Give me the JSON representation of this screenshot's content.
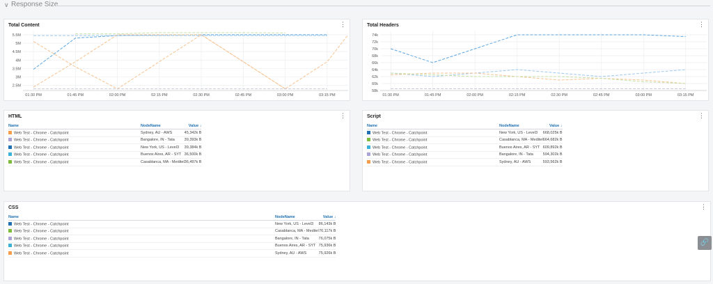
{
  "section": {
    "title": "Response Size",
    "chevron_icon": "chevron-down-icon"
  },
  "panels": {
    "total_content": {
      "title": "Total Content",
      "menu_icon": "more-vert-icon",
      "chart_data": {
        "type": "line",
        "title": "Total Content",
        "ylabel_unit": "M",
        "y_ticks": [
          "5.5M",
          "5M",
          "4.5M",
          "4M",
          "3.5M",
          "3M",
          "2.5M"
        ],
        "x_ticks": [
          "01:30 PM",
          "01:45 PM",
          "02:00 PM",
          "02:15 PM",
          "02:30 PM",
          "02:45 PM",
          "03:00 PM",
          "03:15 PM"
        ],
        "ylim": [
          2.2,
          5.7
        ],
        "grid": true,
        "series": [
          {
            "color": "#5aa5e0",
            "x": [
              "01:30 PM",
              "01:45 PM",
              "02:00 PM",
              "02:15 PM",
              "02:30 PM",
              "02:45 PM",
              "03:00 PM",
              "03:15 PM"
            ],
            "values": [
              3.45,
              5.3,
              5.45,
              5.48,
              5.5,
              5.5,
              5.5,
              5.5
            ]
          },
          {
            "color": "#f5c391",
            "x": [
              "01:30 PM",
              "01:45 PM",
              "02:00 PM",
              "02:15 PM",
              "02:30 PM",
              "02:45 PM",
              "03:00 PM",
              "03:15 PM",
              "03:30 PM"
            ],
            "values": [
              5.1,
              3.6,
              2.3,
              3.9,
              5.5,
              3.9,
              2.3,
              3.9,
              5.5
            ]
          },
          {
            "color": "#f5c391",
            "x": [
              "01:30 PM",
              "01:45 PM",
              "02:00 PM",
              "02:15 PM",
              "02:30 PM",
              "02:45 PM",
              "03:00 PM"
            ],
            "values": [
              2.4,
              3.9,
              5.5,
              5.5,
              5.5,
              3.9,
              2.3
            ]
          },
          {
            "color": "#c8e0a8",
            "x": [
              "01:45 PM",
              "02:00 PM",
              "02:15 PM",
              "02:30 PM",
              "02:45 PM",
              "03:00 PM"
            ],
            "values": [
              5.55,
              5.55,
              5.62,
              5.62,
              5.62,
              5.6
            ]
          },
          {
            "color": "#9ec9ee",
            "x": [
              "01:30 PM",
              "01:45 PM",
              "02:00 PM",
              "02:15 PM",
              "02:30 PM",
              "02:45 PM",
              "03:00 PM",
              "03:15 PM"
            ],
            "values": [
              5.45,
              5.45,
              5.45,
              5.45,
              5.45,
              5.45,
              5.45,
              5.45
            ]
          },
          {
            "color": "#c9c9d6",
            "x": [
              "01:30 PM",
              "01:45 PM",
              "02:00 PM",
              "02:15 PM",
              "02:30 PM",
              "02:45 PM",
              "03:00 PM",
              "03:15 PM"
            ],
            "values": [
              2.3,
              2.3,
              2.3,
              2.3,
              2.3,
              2.3,
              2.3,
              2.3
            ]
          }
        ]
      }
    },
    "total_headers": {
      "title": "Total Headers",
      "menu_icon": "more-vert-icon",
      "chart_data": {
        "type": "line",
        "title": "Total Headers",
        "y_ticks": [
          "74k",
          "72k",
          "70k",
          "68k",
          "66k",
          "64k",
          "62k",
          "60k",
          "58k"
        ],
        "x_ticks": [
          "01:30 PM",
          "01:45 PM",
          "02:00 PM",
          "02:15 PM",
          "02:30 PM",
          "02:45 PM",
          "03:00 PM",
          "03:15 PM"
        ],
        "ylim": [
          58,
          75
        ],
        "grid": true,
        "series": [
          {
            "color": "#5aa5e0",
            "x": [
              "01:30 PM",
              "01:45 PM",
              "02:00 PM",
              "02:15 PM",
              "02:30 PM",
              "02:45 PM",
              "03:00 PM",
              "03:15 PM"
            ],
            "values": [
              70,
              66,
              70,
              74,
              74,
              74,
              74,
              73.5
            ]
          },
          {
            "color": "#9ec9ee",
            "x": [
              "01:30 PM",
              "01:45 PM",
              "02:00 PM",
              "02:15 PM",
              "02:30 PM",
              "02:45 PM",
              "03:00 PM",
              "03:15 PM"
            ],
            "values": [
              63,
              62,
              63,
              64,
              63,
              62,
              63,
              64
            ]
          },
          {
            "color": "#f5c391",
            "x": [
              "01:30 PM",
              "01:45 PM",
              "02:00 PM",
              "02:15 PM",
              "02:30 PM",
              "02:45 PM",
              "03:00 PM",
              "03:15 PM"
            ],
            "values": [
              62.5,
              63,
              63,
              62,
              61,
              61.5,
              61,
              60
            ]
          },
          {
            "color": "#c8e0a8",
            "x": [
              "01:30 PM",
              "01:45 PM",
              "02:00 PM",
              "02:15 PM",
              "02:30 PM",
              "02:45 PM",
              "03:00 PM",
              "03:15 PM"
            ],
            "values": [
              63,
              62.5,
              62,
              62,
              62,
              61.5,
              60.5,
              60
            ]
          },
          {
            "color": "#c9c9d6",
            "x": [
              "01:30 PM",
              "01:45 PM",
              "02:00 PM",
              "02:15 PM",
              "02:30 PM",
              "02:45 PM",
              "03:00 PM",
              "03:15 PM"
            ],
            "values": [
              58.5,
              58.5,
              58.5,
              58.5,
              58.5,
              58.5,
              58.5,
              58.5
            ]
          }
        ]
      }
    },
    "html": {
      "title": "HTML",
      "menu_icon": "more-vert-icon",
      "columns": {
        "name": "Name",
        "node": "NodeName",
        "value": "Value ↓"
      },
      "rows": [
        {
          "color": "#f59d4a",
          "name": "Web Test - Chrome - Catchpoint",
          "node": "Sydney, AU - AWS",
          "value": "45,342k B"
        },
        {
          "color": "#a9a3d6",
          "name": "Web Test - Chrome - Catchpoint",
          "node": "Bangalore, IN - Tata",
          "value": "39,393k B"
        },
        {
          "color": "#1f6fb2",
          "name": "Web Test - Chrome - Catchpoint",
          "node": "New York, US - Level3",
          "value": "39,384k B"
        },
        {
          "color": "#3bb0d8",
          "name": "Web Test - Chrome - Catchpoint",
          "node": "Buenos Aires, AR - SYT",
          "value": "36,500k B"
        },
        {
          "color": "#7cbd3c",
          "name": "Web Test - Chrome - Catchpoint",
          "node": "Casablanca, MA - Meditel",
          "value": "36,497k B"
        }
      ]
    },
    "script": {
      "title": "Script",
      "menu_icon": "more-vert-icon",
      "columns": {
        "name": "Name",
        "node": "NodeName",
        "value": "Value ↓"
      },
      "rows": [
        {
          "color": "#1f6fb2",
          "name": "Web Test - Chrome - Catchpoint",
          "node": "New York, US - Level3",
          "value": "668,025k B"
        },
        {
          "color": "#7cbd3c",
          "name": "Web Test - Chrome - Catchpoint",
          "node": "Casablanca, MA - Meditel",
          "value": "664,682k B"
        },
        {
          "color": "#3bb0d8",
          "name": "Web Test - Chrome - Catchpoint",
          "node": "Buenos Aires, AR - SYT",
          "value": "609,892k B"
        },
        {
          "color": "#a9a3d6",
          "name": "Web Test - Chrome - Catchpoint",
          "node": "Bangalore, IN - Tata",
          "value": "594,302k B"
        },
        {
          "color": "#f59d4a",
          "name": "Web Test - Chrome - Catchpoint",
          "node": "Sydney, AU - AWS",
          "value": "593,562k B"
        }
      ]
    },
    "css": {
      "title": "CSS",
      "menu_icon": "more-vert-icon",
      "columns": {
        "name": "Name",
        "node": "NodeName",
        "value": "Value ↓"
      },
      "rows": [
        {
          "color": "#1f6fb2",
          "name": "Web Test - Chrome - Catchpoint",
          "node": "New York, US - Level3",
          "value": "86,143k B"
        },
        {
          "color": "#7cbd3c",
          "name": "Web Test - Chrome - Catchpoint",
          "node": "Casablanca, MA - Meditel",
          "value": "76,117k B"
        },
        {
          "color": "#a9a3d6",
          "name": "Web Test - Chrome - Catchpoint",
          "node": "Bangalore, IN - Tata",
          "value": "76,075k B"
        },
        {
          "color": "#3bb0d8",
          "name": "Web Test - Chrome - Catchpoint",
          "node": "Buenos Aires, AR - SYT",
          "value": "75,936k B"
        },
        {
          "color": "#f59d4a",
          "name": "Web Test - Chrome - Catchpoint",
          "node": "Sydney, AU - AWS",
          "value": "75,926k B"
        }
      ]
    }
  },
  "side_link": {
    "icon": "link-icon"
  }
}
